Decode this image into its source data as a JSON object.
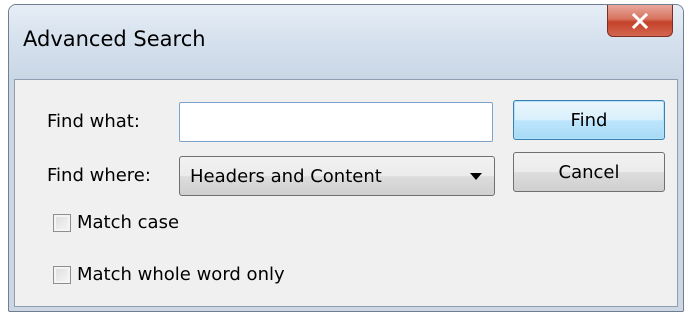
{
  "window": {
    "title": "Advanced Search",
    "close_glyph": "X"
  },
  "form": {
    "find_what_label": "Find what:",
    "find_what_value": "",
    "find_where_label": "Find where:",
    "find_where_value": "Headers and Content"
  },
  "buttons": {
    "find_label": "Find",
    "cancel_label": "Cancel"
  },
  "options": {
    "match_case_label": "Match case",
    "match_case_checked": false,
    "whole_word_label": "Match whole word only",
    "whole_word_checked": false
  },
  "icons": {
    "close": "close-icon",
    "dropdown": "chevron-down-icon"
  },
  "colors": {
    "close_button": "#c4422b",
    "default_button_border": "#3c7fb1",
    "input_border": "#7da2ce"
  }
}
